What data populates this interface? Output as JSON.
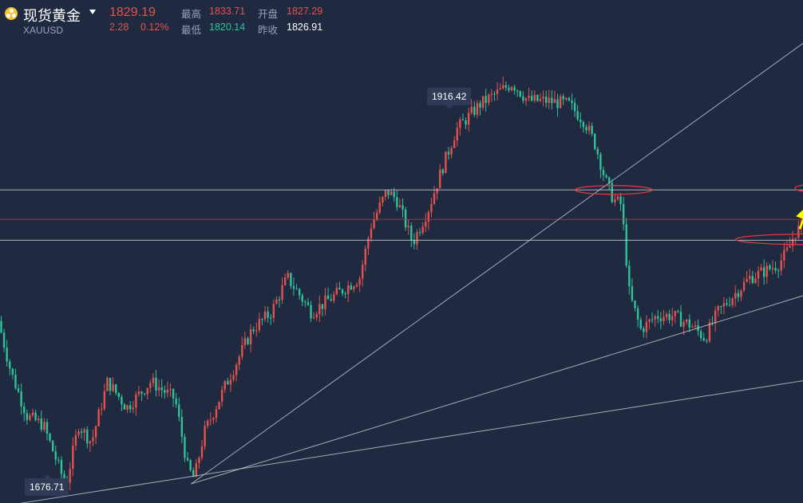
{
  "header": {
    "name": "现货黄金",
    "symbol": "XAUUSD",
    "price": "1829.19",
    "change": "2.28",
    "change_pct": "0.12%",
    "high_label": "最高",
    "high_value": "1833.71",
    "open_label": "开盘",
    "open_value": "1827.29",
    "low_label": "最低",
    "low_value": "1820.14",
    "prev_close_label": "昨收",
    "prev_close_value": "1826.91"
  },
  "colors": {
    "background": "#1f2940",
    "up": "#e4524d",
    "down": "#2fc29b",
    "trendline": "#bcc2cc",
    "arrow": "#ffff00",
    "ellipse": "#e23a3a"
  },
  "chart_data": {
    "type": "candlestick",
    "ylim": [
      1670,
      1960
    ],
    "max_label": "1916.42",
    "min_label": "1676.71",
    "max_value": 1916.42,
    "min_value": 1676.71,
    "bar_count": 280,
    "anchors": [
      [
        0,
        1775
      ],
      [
        8,
        1745
      ],
      [
        18,
        1720
      ],
      [
        28,
        1715
      ],
      [
        42,
        1680
      ],
      [
        50,
        1715
      ],
      [
        58,
        1705
      ],
      [
        68,
        1740
      ],
      [
        80,
        1725
      ],
      [
        95,
        1740
      ],
      [
        110,
        1730
      ],
      [
        118,
        1690
      ],
      [
        122,
        1684
      ],
      [
        128,
        1710
      ],
      [
        140,
        1735
      ],
      [
        158,
        1770
      ],
      [
        170,
        1780
      ],
      [
        180,
        1800
      ],
      [
        195,
        1780
      ],
      [
        210,
        1790
      ],
      [
        225,
        1800
      ],
      [
        232,
        1830
      ],
      [
        242,
        1850
      ],
      [
        248,
        1845
      ],
      [
        258,
        1820
      ],
      [
        268,
        1840
      ],
      [
        276,
        1862
      ],
      [
        285,
        1885
      ],
      [
        300,
        1900
      ],
      [
        310,
        1906
      ],
      [
        320,
        1912
      ],
      [
        330,
        1902
      ],
      [
        340,
        1902
      ],
      [
        355,
        1900
      ],
      [
        365,
        1890
      ],
      [
        372,
        1876
      ],
      [
        378,
        1856
      ],
      [
        383,
        1845
      ],
      [
        388,
        1842
      ],
      [
        393,
        1790
      ],
      [
        400,
        1770
      ],
      [
        410,
        1778
      ],
      [
        420,
        1778
      ],
      [
        432,
        1772
      ],
      [
        440,
        1765
      ],
      [
        448,
        1780
      ],
      [
        458,
        1790
      ],
      [
        468,
        1800
      ],
      [
        478,
        1804
      ],
      [
        486,
        1808
      ],
      [
        492,
        1816
      ],
      [
        496,
        1826
      ],
      [
        500,
        1829
      ]
    ],
    "horizontal_levels": [
      1850.5,
      1833.5,
      1821.5
    ],
    "trendlines": [
      {
        "from": [
          119,
          1681
        ],
        "to": [
          560,
          1975
        ]
      },
      {
        "from": [
          119,
          1681
        ],
        "to": [
          600,
          1818
        ]
      },
      {
        "from": [
          0,
          1668
        ],
        "to": [
          600,
          1755
        ]
      }
    ],
    "ellipses": [
      {
        "x": 382,
        "y": 1850.5,
        "rx": 24,
        "ry": 2.5
      },
      {
        "x": 512,
        "y": 1851.5,
        "rx": 17,
        "ry": 2.5
      },
      {
        "x": 502,
        "y": 1822,
        "rx": 44,
        "ry": 3
      }
    ],
    "arrows": [
      {
        "points": [
          [
            503,
            1826
          ],
          [
            508,
            1840
          ]
        ]
      },
      {
        "points": [
          [
            506,
            1838
          ],
          [
            510,
            1848
          ],
          [
            517,
            1828
          ],
          [
            525,
            1867
          ]
        ]
      },
      {
        "points": [
          [
            498,
            1828
          ],
          [
            502,
            1838
          ]
        ]
      }
    ]
  }
}
